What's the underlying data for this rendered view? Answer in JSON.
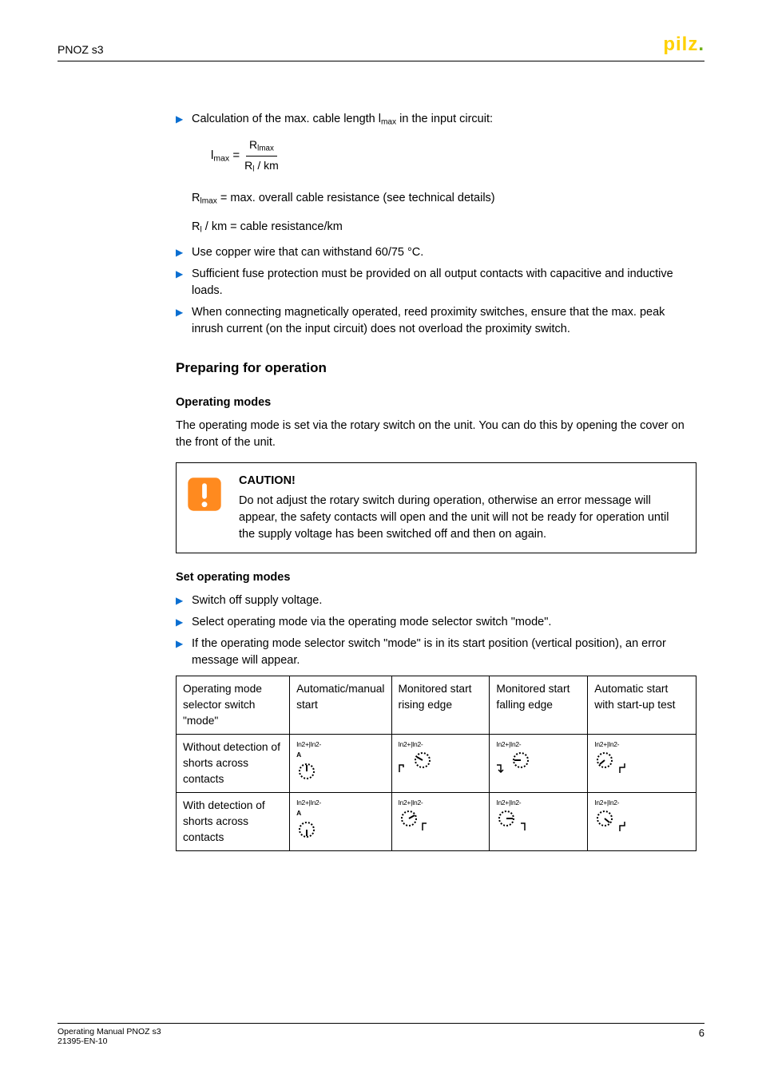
{
  "header": {
    "title": "PNOZ s3",
    "logo_main": "pilz",
    "logo_dot": "."
  },
  "b1": "Calculation of the max. cable length l",
  "b1_sub": "max",
  "b1_tail": " in the input circuit:",
  "formula": {
    "lhs_l": "l",
    "lhs_sub": "max",
    "eq": " = ",
    "top_l": "R",
    "top_sub": "lmax",
    "bot_l": "R",
    "bot_sub": "l",
    "bot_tail": " / km"
  },
  "note1_a": "R",
  "note1_sub": "lmax",
  "note1_b": " = max. overall cable resistance (see technical details)",
  "note2_a": "R",
  "note2_sub": "l",
  "note2_b": " / km = cable resistance/km",
  "b2": "Use copper wire that can withstand 60/75 °C.",
  "b3": "Sufficient fuse protection must be provided on all output contacts with capacitive and inductive loads.",
  "b4": "When connecting magnetically operated, reed proximity switches, ensure that the max. peak inrush current (on the input circuit) does not overload the proximity switch.",
  "h_prep": "Preparing for operation",
  "h_opmodes": "Operating modes",
  "p_opmodes": "The operating mode is set via the rotary switch on the unit. You can do this by opening the cover on the front of the unit.",
  "caution_title": "CAUTION!",
  "caution_body": "Do not adjust the rotary switch during operation, otherwise an error message will appear, the safety contacts will open and the unit will not be ready for operation until the supply voltage has been switched off and then on again.",
  "h_setop": "Set operating modes",
  "s1": "Switch off supply voltage.",
  "s2": "Select operating mode via the operating mode selector switch \"mode\".",
  "s3": "If the operating mode selector switch \"mode\" is in its start position (vertical position), an error message will appear.",
  "table": {
    "h0": "Operating mode selector switch \"mode\"",
    "h1": "Automatic/manual start",
    "h2": "Monitored start rising edge",
    "h3": "Monitored start falling edge",
    "h4": "Automatic start with start-up test",
    "r1": "Without detection of shorts across contacts",
    "r2": "With detection of shorts across contacts",
    "mini": "In2+|In2-",
    "miniA": "A"
  },
  "footer": {
    "l1": "Operating Manual PNOZ s3",
    "l2": "21395-EN-10",
    "page": "6"
  }
}
